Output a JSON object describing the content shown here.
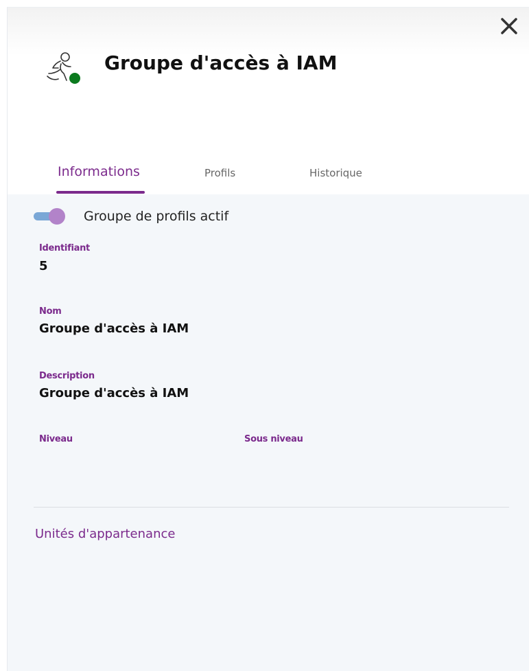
{
  "panel": {
    "title": "Groupe d'accès à IAM",
    "close_icon": "close-icon",
    "group_icon": "running-person-icon",
    "status_color": "#0b7a1e"
  },
  "tabs": [
    {
      "label": "Informations",
      "active": true
    },
    {
      "label": "Profils",
      "active": false
    },
    {
      "label": "Historique",
      "active": false
    }
  ],
  "toggle": {
    "label": "Groupe de profils actif",
    "checked": true
  },
  "fields": {
    "identifiant": {
      "label": "Identifiant",
      "value": "5"
    },
    "nom": {
      "label": "Nom",
      "value": "Groupe d'accès à IAM"
    },
    "description": {
      "label": "Description",
      "value": "Groupe d'accès à IAM"
    },
    "niveau": {
      "label": "Niveau",
      "value": ""
    },
    "sous_niveau": {
      "label": "Sous niveau",
      "value": ""
    }
  },
  "section": {
    "unites_title": "Unités d'appartenance"
  },
  "colors": {
    "accent": "#7b2a8c",
    "toggle_track": "#7aa7d6",
    "toggle_knob": "#b283c9",
    "background": "#f4f7fa"
  }
}
